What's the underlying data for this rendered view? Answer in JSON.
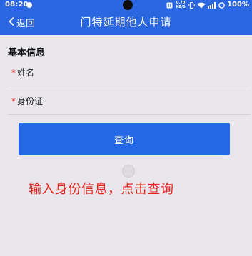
{
  "status_bar": {
    "time": "08:20",
    "net_speed_value": "0.70",
    "net_speed_unit": "KB/S",
    "battery": "100%"
  },
  "header": {
    "back_label": "返回",
    "title": "门特延期他人申请"
  },
  "form": {
    "section_title": "基本信息",
    "required_mark": "*",
    "name_label": "姓名",
    "id_label": "身份证"
  },
  "actions": {
    "query_label": "查询"
  },
  "annotation": {
    "text": "输入身份信息，点击查询"
  },
  "colors": {
    "brand_blue": "#2a66e0",
    "button_blue": "#2567e4",
    "annotation_red": "#e8231c",
    "required_red": "#e0302a",
    "page_background": "#e9e6ec"
  }
}
